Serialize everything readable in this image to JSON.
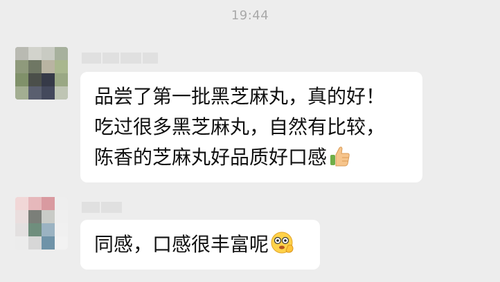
{
  "timestamp": "19:44",
  "messages": [
    {
      "lines": [
        "品尝了第一批黑芝麻丸，真的好！",
        "吃过很多黑芝麻丸，自然有比较，",
        "陈香的芝麻丸好品质好口感"
      ],
      "emoji": "thumbs-up-icon"
    },
    {
      "lines": [
        "同感，口感很丰富呢"
      ],
      "emoji": "smiling-face-eyes-hand-icon"
    }
  ],
  "colors": {
    "background": "#ededed",
    "bubble": "#ffffff",
    "timestamp": "#a9a9a9",
    "text": "#111111"
  }
}
